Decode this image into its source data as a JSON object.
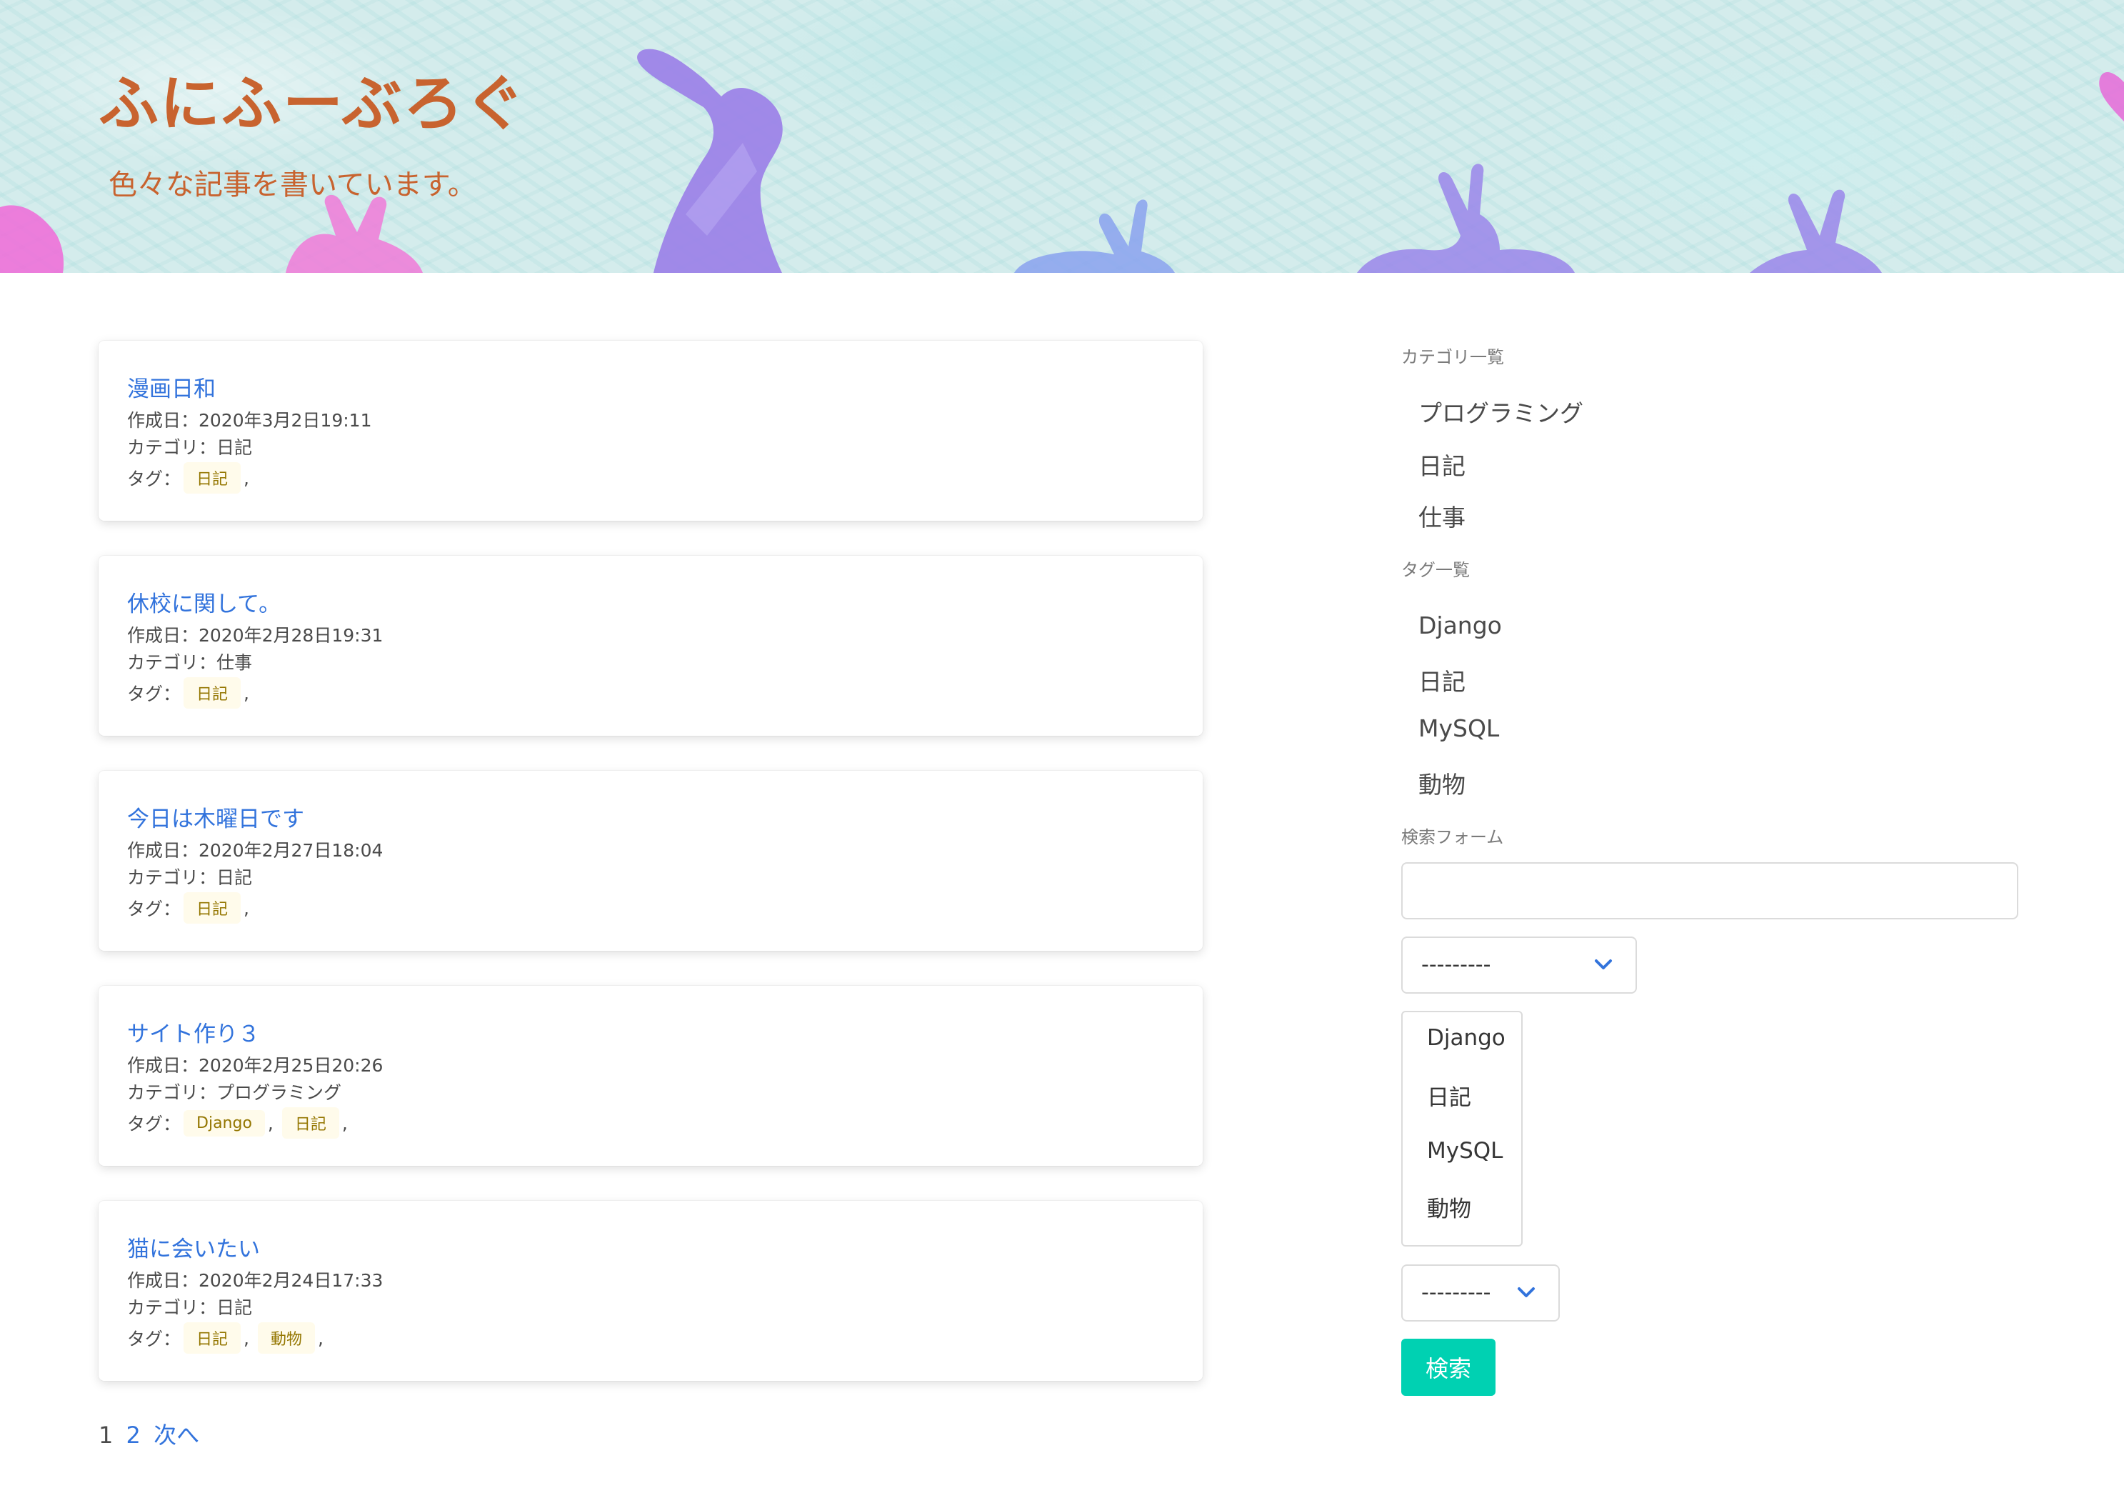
{
  "site": {
    "title": "ふにふーぶろぐ",
    "subtitle": "色々な記事を書いています。"
  },
  "posts": [
    {
      "title": "漫画日和",
      "created": "作成日：2020年3月2日19:11",
      "category": "カテゴリ：日記",
      "tags_label": "タグ：",
      "tags": [
        "日記"
      ]
    },
    {
      "title": "休校に関して。",
      "created": "作成日：2020年2月28日19:31",
      "category": "カテゴリ：仕事",
      "tags_label": "タグ：",
      "tags": [
        "日記"
      ]
    },
    {
      "title": "今日は木曜日です",
      "created": "作成日：2020年2月27日18:04",
      "category": "カテゴリ：日記",
      "tags_label": "タグ：",
      "tags": [
        "日記"
      ]
    },
    {
      "title": "サイト作り３",
      "created": "作成日：2020年2月25日20:26",
      "category": "カテゴリ：プログラミング",
      "tags_label": "タグ：",
      "tags": [
        "Django",
        "日記"
      ]
    },
    {
      "title": "猫に会いたい",
      "created": "作成日：2020年2月24日17:33",
      "category": "カテゴリ：日記",
      "tags_label": "タグ：",
      "tags": [
        "日記",
        "動物"
      ]
    }
  ],
  "tag_separator": ",",
  "pagination": {
    "current": "1",
    "page2": "2",
    "next": "次へ"
  },
  "sidebar": {
    "categories_label": "カテゴリ一覧",
    "categories": [
      "プログラミング",
      "日記",
      "仕事"
    ],
    "tags_label": "タグ一覧",
    "tags": [
      "Django",
      "日記",
      "MySQL",
      "動物"
    ],
    "search_label": "検索フォーム",
    "search_value": "",
    "select1_value": "---------",
    "multi_options": [
      "Django",
      "日記",
      "MySQL",
      "動物"
    ],
    "select2_value": "---------",
    "search_button": "検索"
  },
  "colors": {
    "title": "#c8632f",
    "link": "#3273dc",
    "tag_bg": "#fffbeb",
    "tag_text": "#947600",
    "button": "#00d1b2"
  }
}
